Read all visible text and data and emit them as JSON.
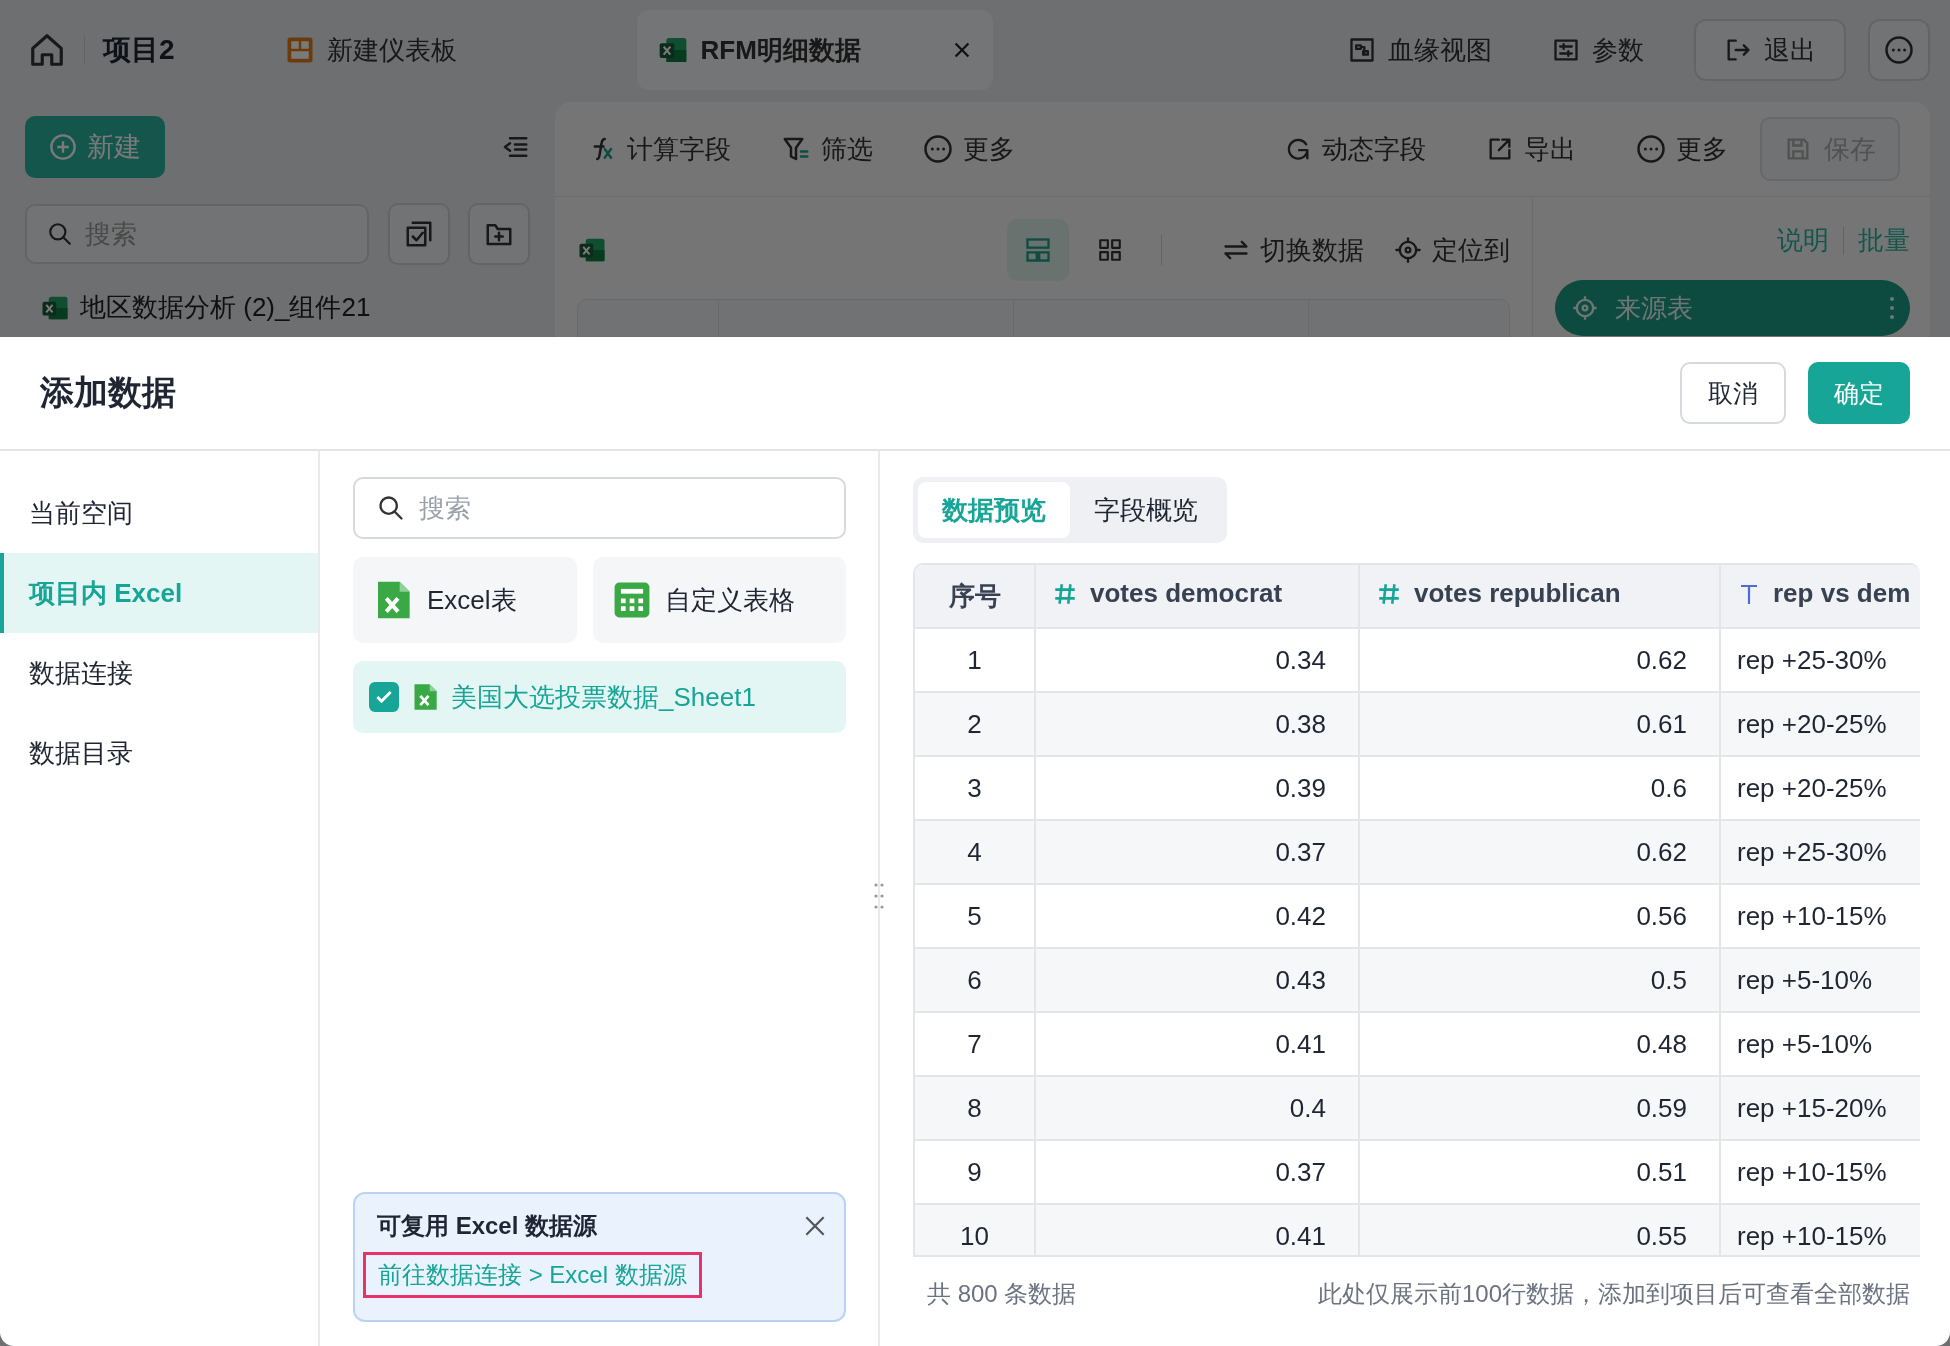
{
  "background": {
    "top_bar": {
      "project": "项目2",
      "tabs": [
        {
          "kind": "dashboard",
          "label": "新建仪表板",
          "selected": false
        },
        {
          "kind": "excel",
          "label": "RFM明细数据",
          "selected": true
        }
      ],
      "actions": [
        {
          "kind": "lineage",
          "label": "血缘视图"
        },
        {
          "kind": "params",
          "label": "参数"
        }
      ],
      "exit_button": "退出"
    },
    "sidebar": {
      "new_button": "新建",
      "search": {
        "placeholder": "搜索"
      },
      "items": [
        {
          "label": "地区数据分析 (2)_组件21"
        }
      ]
    },
    "toolbar": {
      "left": [
        {
          "kind": "formula",
          "label": "计算字段"
        },
        {
          "kind": "filter",
          "label": "筛选"
        },
        {
          "kind": "more",
          "label": "更多"
        }
      ],
      "right": [
        {
          "kind": "dynamic",
          "label": "动态字段"
        },
        {
          "kind": "export",
          "label": "导出"
        },
        {
          "kind": "more",
          "label": "更多"
        }
      ],
      "save_button": {
        "label": "保存",
        "disabled": true
      }
    },
    "view_bar": {
      "views": [
        {
          "kind": "table",
          "selected": true
        },
        {
          "kind": "grid",
          "selected": false
        }
      ],
      "actions": [
        {
          "kind": "switch",
          "label": "切换数据"
        },
        {
          "kind": "locate",
          "label": "定位到"
        }
      ]
    },
    "side_panel": {
      "links": [
        "说明",
        "批量"
      ],
      "node": "来源表"
    }
  },
  "dialog": {
    "title": "添加数据",
    "cancel": "取消",
    "confirm": "确定",
    "nav": [
      {
        "label": "当前空间",
        "selected": false
      },
      {
        "label": "项目内 Excel",
        "selected": true
      },
      {
        "label": "数据连接",
        "selected": false
      },
      {
        "label": "数据目录",
        "selected": false
      }
    ],
    "search": {
      "placeholder": "搜索"
    },
    "sources": [
      {
        "kind": "excel",
        "label": "Excel表"
      },
      {
        "kind": "custom",
        "label": "自定义表格"
      }
    ],
    "files": [
      {
        "label": "美国大选投票数据_Sheet1",
        "checked": true,
        "selected": true
      }
    ],
    "notice": {
      "title": "可复用 Excel 数据源",
      "link": {
        "label": "前往数据连接 > Excel 数据源",
        "highlighted": true
      }
    },
    "preview": {
      "tabs": [
        {
          "label": "数据预览",
          "selected": true
        },
        {
          "label": "字段概览",
          "selected": false
        }
      ],
      "columns": [
        {
          "kind": "seq",
          "label": "序号"
        },
        {
          "kind": "number",
          "label": "votes democrat"
        },
        {
          "kind": "number",
          "label": "votes republican"
        },
        {
          "kind": "text",
          "label": "rep vs dem"
        }
      ],
      "rows": [
        [
          "1",
          "0.34",
          "0.62",
          "rep +25-30%"
        ],
        [
          "2",
          "0.38",
          "0.61",
          "rep +20-25%"
        ],
        [
          "3",
          "0.39",
          "0.6",
          "rep +20-25%"
        ],
        [
          "4",
          "0.37",
          "0.62",
          "rep +25-30%"
        ],
        [
          "5",
          "0.42",
          "0.56",
          "rep +10-15%"
        ],
        [
          "6",
          "0.43",
          "0.5",
          "rep +5-10%"
        ],
        [
          "7",
          "0.41",
          "0.48",
          "rep +5-10%"
        ],
        [
          "8",
          "0.4",
          "0.59",
          "rep +15-20%"
        ],
        [
          "9",
          "0.37",
          "0.51",
          "rep +10-15%"
        ],
        [
          "10",
          "0.41",
          "0.55",
          "rep +10-15%"
        ]
      ],
      "total": "共 800 条数据",
      "hint": "此处仅展示前100行数据，添加到项目后可查看全部数据"
    }
  }
}
